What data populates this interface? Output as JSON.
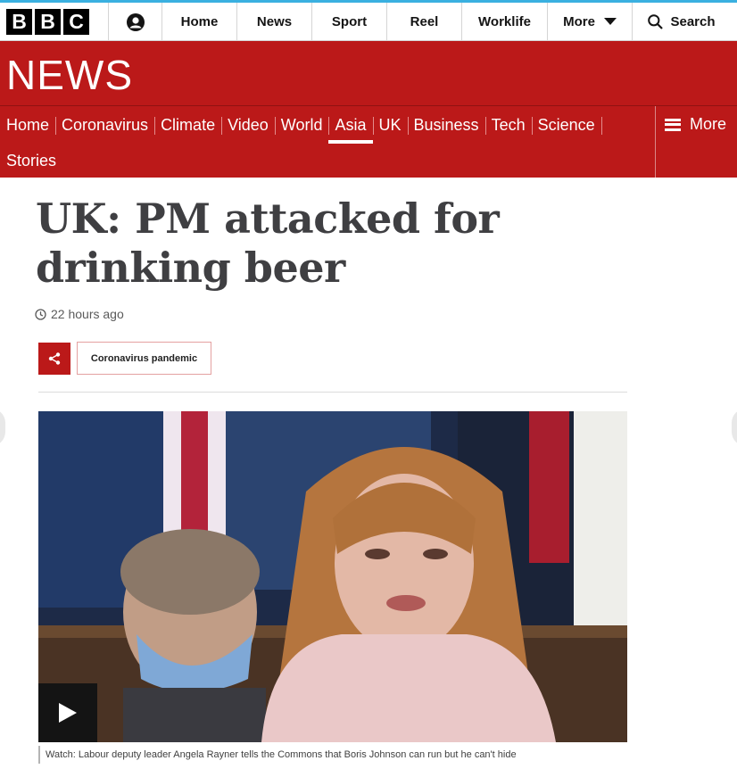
{
  "brand": {
    "bbc_letters": [
      "B",
      "B",
      "C"
    ],
    "section_title": "NEWS"
  },
  "top_nav": {
    "items": [
      "Home",
      "News",
      "Sport",
      "Reel",
      "Worklife"
    ],
    "more_label": "More",
    "search_label": "Search"
  },
  "section_nav": {
    "row1": [
      "Home",
      "Coronavirus",
      "Climate",
      "Video",
      "World",
      "Asia",
      "UK",
      "Business",
      "Tech",
      "Science"
    ],
    "row2": [
      "Stories"
    ],
    "active": "Asia",
    "more_label": "More"
  },
  "article": {
    "headline": "UK: PM attacked for drinking beer",
    "timestamp": "22 hours ago",
    "tag": "Coronavirus pandemic",
    "video_caption": "Watch: Labour deputy leader Angela Rayner tells the Commons that Boris Johnson can run but he can't hide"
  },
  "colors": {
    "brand_red": "#bb1919",
    "headline_text": "#3f3f42"
  },
  "icons": {
    "account": "account-icon",
    "search": "search-icon",
    "more_caret": "caret-down-icon",
    "menu": "hamburger-icon",
    "clock": "clock-icon",
    "share": "share-icon",
    "play": "play-icon"
  }
}
